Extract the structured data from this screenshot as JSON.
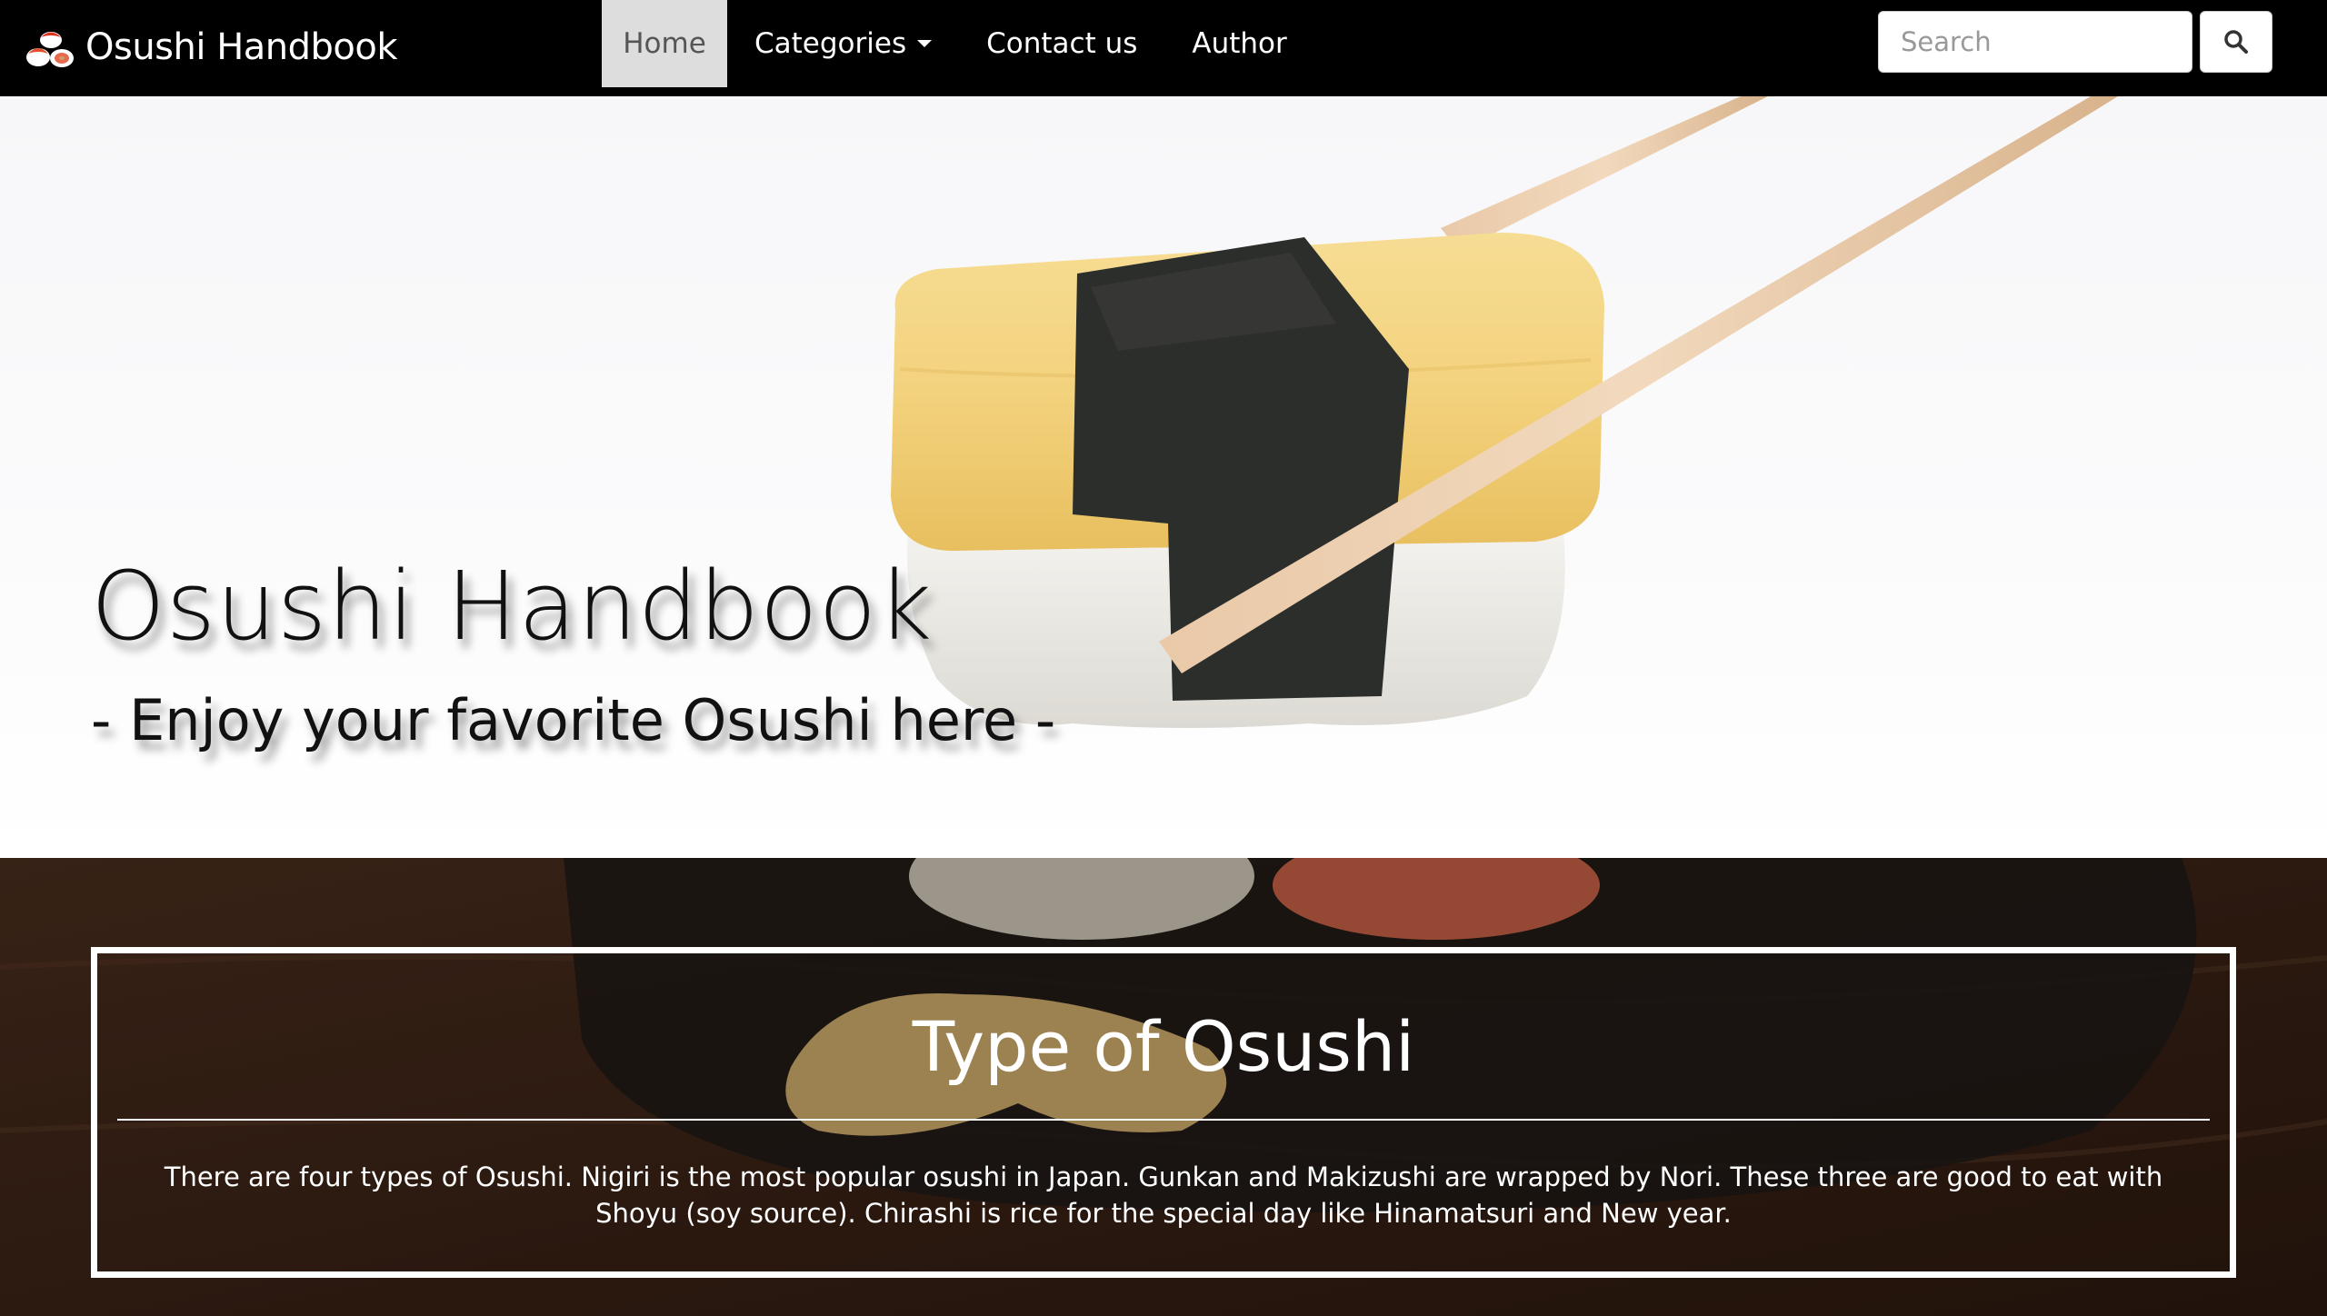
{
  "navbar": {
    "brand": "Osushi Handbook",
    "links": [
      {
        "label": "Home"
      },
      {
        "label": "Categories"
      },
      {
        "label": "Contact us"
      },
      {
        "label": "Author"
      }
    ],
    "search_placeholder": "Search"
  },
  "hero": {
    "title": "Osushi Handbook",
    "subtitle": "- Enjoy your favorite Osushi here -"
  },
  "types": {
    "title": "Type of Osushi",
    "text": "There are four types of Osushi. Nigiri is the most popular osushi in Japan. Gunkan and Makizushi are wrapped by Nori. These three are good to eat with Shoyu (soy source). Chirashi is rice for the special day like Hinamatsuri and New year."
  },
  "colors": {
    "navbar": "#000000",
    "active_tab": "#dddddd",
    "section_overlay": "#2a1a12"
  }
}
